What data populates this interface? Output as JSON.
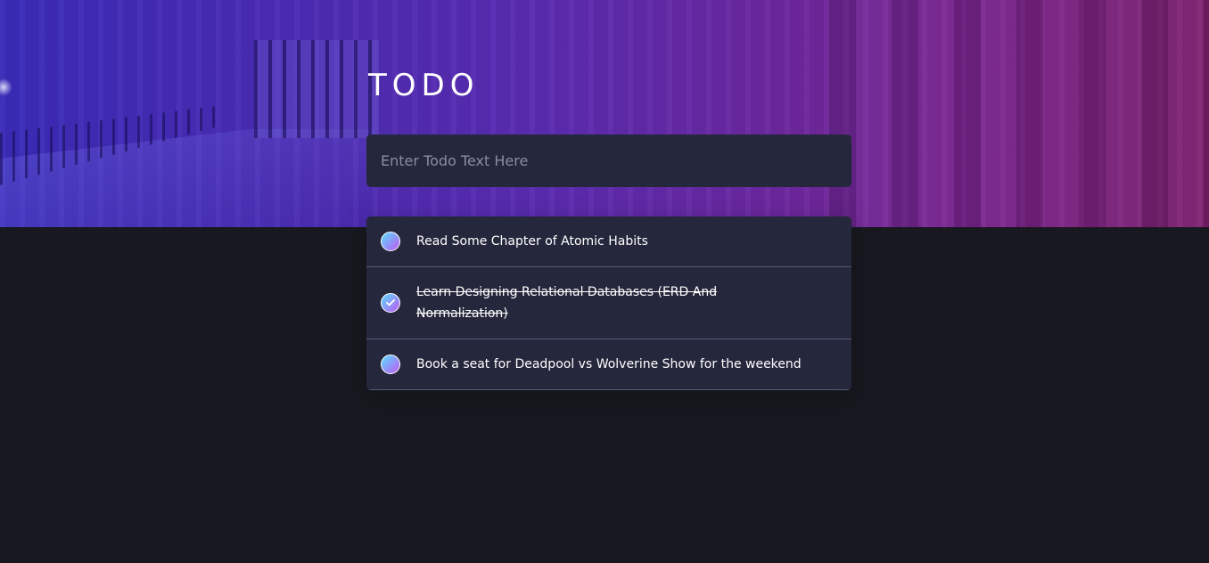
{
  "app": {
    "title": "TODO"
  },
  "new_todo": {
    "placeholder": "Enter Todo Text Here",
    "value": ""
  },
  "todos": [
    {
      "text": "Read Some Chapter of Atomic Habits",
      "completed": false
    },
    {
      "text": "Learn Designing Relational Databases (ERD And Normalization)",
      "completed": true
    },
    {
      "text": "Book a seat for Deadpool vs Wolverine Show for the weekend",
      "completed": false
    }
  ],
  "icons": {
    "check": "check-icon",
    "circle": "circle-icon"
  },
  "colors": {
    "background": "#181820",
    "card": "#25273c",
    "divider": "#5a5b73",
    "check_gradient_start": "#57ddff",
    "check_gradient_end": "#c058f3",
    "hero_left": "#3a2bb8",
    "hero_right": "#7d206f"
  }
}
